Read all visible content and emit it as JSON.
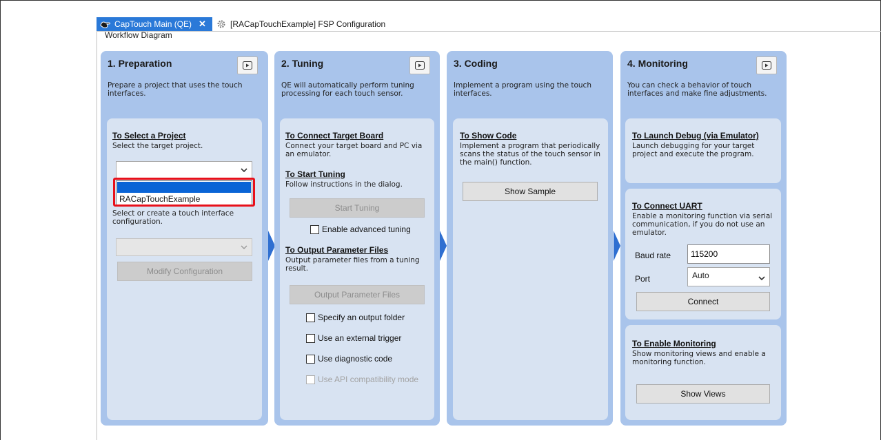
{
  "tabs": [
    {
      "label": "CapTouch Main (QE)",
      "icon": "hand-touch-icon",
      "active": true
    },
    {
      "label": "[RACapTouchExample] FSP Configuration",
      "icon": "gear-icon",
      "active": false
    }
  ],
  "view_title": "Workflow Diagram",
  "columns": {
    "preparation": {
      "title": "1. Preparation",
      "description": "Prepare a project that uses the touch interfaces.",
      "select_project": {
        "title": "To Select a Project",
        "description": "Select the target project.",
        "dropdown_value": "",
        "dropdown_options": [
          "",
          "RACapTouchExample"
        ]
      },
      "select_config": {
        "description": "Select or create a touch interface configuration.",
        "dropdown_value": "",
        "modify_button": "Modify Configuration"
      }
    },
    "tuning": {
      "title": "2. Tuning",
      "description": "QE will automatically perform tuning processing for each touch sensor.",
      "connect": {
        "title": "To Connect Target Board",
        "description": "Connect your target board and PC via an emulator."
      },
      "start": {
        "title": "To Start Tuning",
        "description": "Follow instructions in the dialog.",
        "button": "Start Tuning",
        "advanced": "Enable advanced tuning"
      },
      "output": {
        "title": "To Output Parameter Files",
        "description": "Output parameter files from a tuning result.",
        "button": "Output Parameter Files",
        "options": [
          "Specify an output folder",
          "Use an external trigger",
          "Use diagnostic code",
          "Use API compatibility mode"
        ]
      }
    },
    "coding": {
      "title": "3. Coding",
      "description": "Implement a program using the touch interfaces.",
      "show_code": {
        "title": "To Show Code",
        "description": "Implement a program that periodically scans the status of the touch sensor in the main() function.",
        "button": "Show Sample"
      }
    },
    "monitoring": {
      "title": "4. Monitoring",
      "description": "You can check a behavior of touch interfaces and make fine adjustments.",
      "debug": {
        "title": "To Launch Debug (via Emulator)",
        "description": "Launch debugging for your target project and execute the program."
      },
      "uart": {
        "title": "To Connect UART",
        "description": "Enable a monitoring function via serial communication, if you do not use an emulator.",
        "baud_label": "Baud rate",
        "baud_value": "115200",
        "port_label": "Port",
        "port_value": "Auto",
        "connect_button": "Connect"
      },
      "enable": {
        "title": "To Enable Monitoring",
        "description": "Show monitoring views and enable a monitoring function.",
        "button": "Show Views"
      }
    }
  },
  "colors": {
    "column_bg": "#a9c4eb",
    "panel_bg": "#d8e3f2",
    "tab_active": "#2a79d8",
    "arrow": "#2f6fd1",
    "highlight": "#e8101a",
    "dropdown_selection": "#0a64d6"
  }
}
